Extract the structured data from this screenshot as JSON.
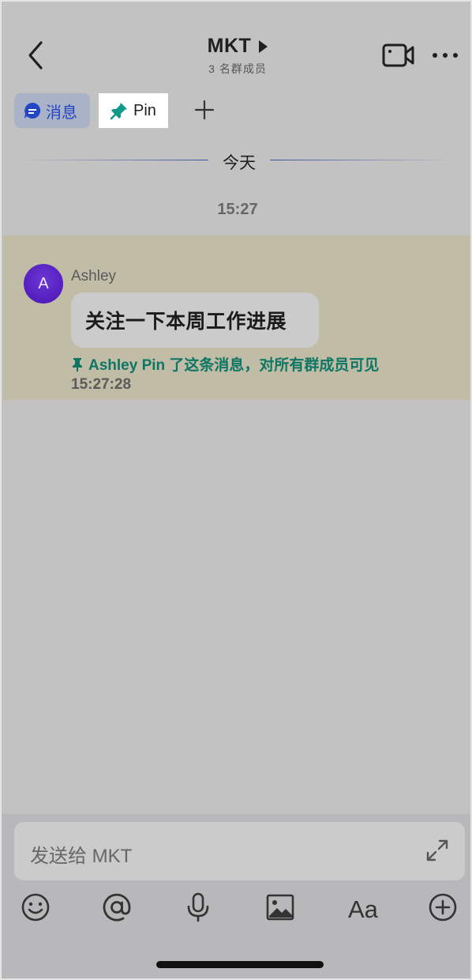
{
  "header": {
    "title": "MKT",
    "subtitle": "3 名群成员"
  },
  "tabs": [
    {
      "label": "消息",
      "icon": "message-bubble-icon",
      "color": "#2346c4"
    },
    {
      "label": "Pin",
      "icon": "pin-icon",
      "color": "#0e9a86"
    }
  ],
  "divider": {
    "label": "今天"
  },
  "time_separator": "15:27",
  "message": {
    "avatar_letter": "A",
    "sender": "Ashley",
    "text": "关注一下本周工作进展",
    "pin_note": "Ashley Pin 了这条消息，对所有群成员可见",
    "timestamp": "15:27:28",
    "highlight_color": "#c1bca5"
  },
  "input": {
    "placeholder": "发送给 MKT"
  },
  "toolbar": {
    "items": [
      "emoji-icon",
      "mention-icon",
      "microphone-icon",
      "image-icon",
      "text-format-icon",
      "add-icon"
    ],
    "format_label": "Aa"
  }
}
